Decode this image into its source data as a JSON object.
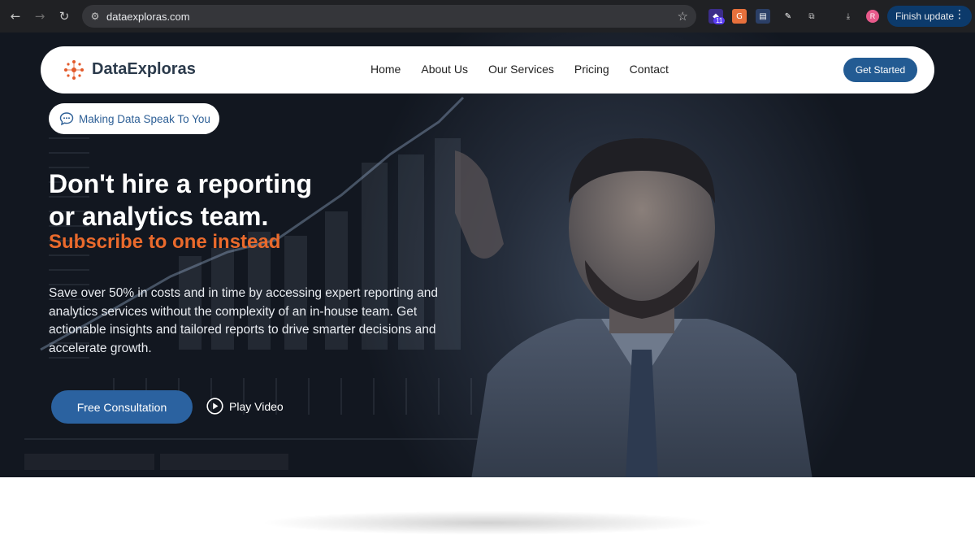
{
  "browser": {
    "url": "dataexploras.com",
    "finish_update_label": "Finish update",
    "extension_badge": "11",
    "profile_initial": "R",
    "ext_g_label": "G"
  },
  "navbar": {
    "brand": "DataExploras",
    "links": [
      "Home",
      "About Us",
      "Our Services",
      "Pricing",
      "Contact"
    ],
    "cta_label": "Get Started"
  },
  "hero": {
    "chip_text": "Making Data Speak To You",
    "headline_line1": "Don't hire a reporting",
    "headline_line2": "or analytics team.",
    "subheadline": "Subscribe to one instead",
    "description": "Save over 50% in costs and in time by accessing expert reporting and analytics services without the complexity of an in-house team. Get actionable insights and tailored reports to drive smarter decisions and accelerate growth.",
    "primary_button": "Free Consultation",
    "video_label": "Play Video"
  },
  "colors": {
    "brand_blue": "#235b93",
    "accent_orange": "#ea6a2c",
    "chip_text": "#2d5f96"
  }
}
